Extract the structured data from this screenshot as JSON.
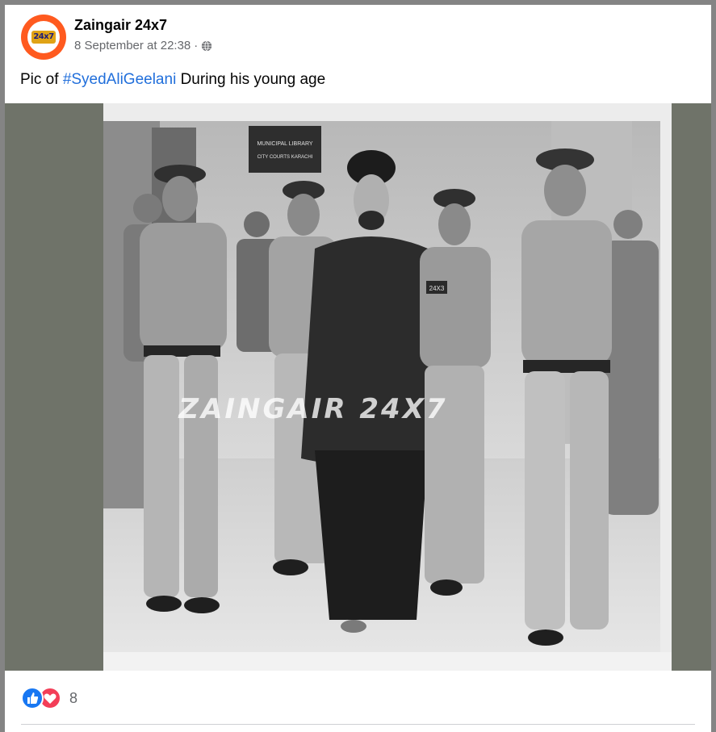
{
  "post": {
    "page_name": "Zaingair 24x7",
    "timestamp": "8 September at 22:38",
    "separator": "·",
    "privacy_icon": "globe-icon",
    "caption_prefix": "Pic of ",
    "hashtag": "#SyedAliGeelani",
    "caption_suffix": " During his young age",
    "avatar_logo_text": "24x7"
  },
  "photo": {
    "watermark": "ZAINGAIR 24X7",
    "sign_line1": "MUNICIPAL LIBRARY",
    "sign_line2": "CITY COURTS KARACHI",
    "badge_text": "24X3"
  },
  "reactions": {
    "icons": [
      "like-icon",
      "love-icon"
    ],
    "count": "8"
  },
  "colors": {
    "hashtag": "#216fdb",
    "like": "#1877f2",
    "love": "#f33e58",
    "avatar_ring": "#ff5a1f",
    "media_background": "#6f7369"
  }
}
